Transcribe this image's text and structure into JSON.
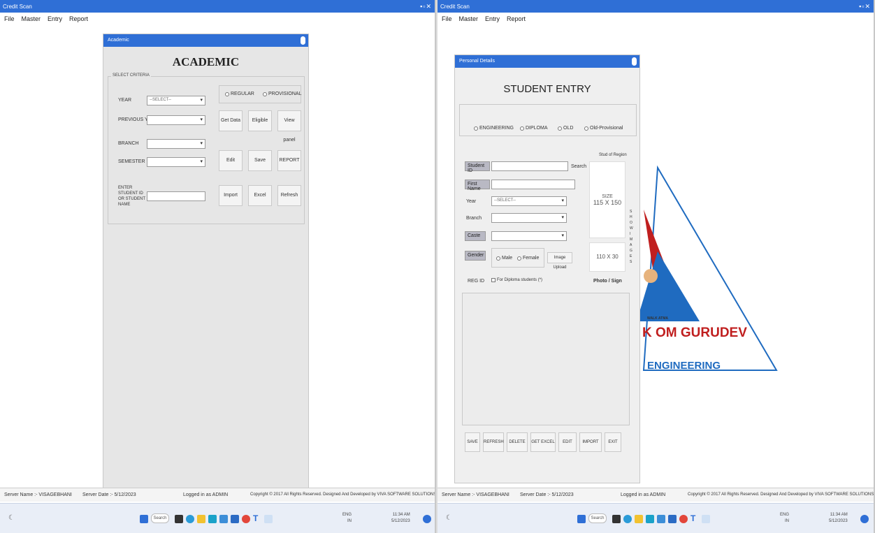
{
  "colors": {
    "titlebar": "#2f6fd6",
    "accent_red": "#c01f1f",
    "accent_blue": "#1f6bc0"
  },
  "window": {
    "title": "Credit Scan",
    "controls": "▪▫✕",
    "menu": [
      "File",
      "Master",
      "Entry",
      "Report"
    ]
  },
  "status": {
    "server_name": "Server Name :- VISAGEBHANI",
    "server_date": "Server Date :- 5/12/2023",
    "logged_in": "Logged in as ADMIN",
    "copyright": "Copyright © 2017 All Rights Reserved. Designed And Developed by VIVA SOFTWARE SOLUTIONS"
  },
  "taskbar": {
    "search": "Search",
    "tray_lang": "ENG\nIN",
    "tray_time": "11:34 AM\n5/12/2023"
  },
  "academic": {
    "title": "Academic",
    "heading": "ACADEMIC",
    "criteria_legend": "SELECT CRITERIA",
    "year_label": "YEAR",
    "year_value": "--SELECT--",
    "prev_year_label": "PREVIOUS YEAR",
    "branch_label": "BRANCH",
    "semester_label": "SEMESTER",
    "enter_label": "ENTER STUDENT ID OR STUDENT NAME",
    "regular": "REGULAR",
    "provisional": "PROVISIONAL",
    "buttons": {
      "get_data": "Get Data",
      "eligible": "Eligible",
      "view_panel": "View panel",
      "edit": "Edit",
      "save": "Save",
      "report": "REPORT",
      "import": "Import",
      "excel": "Excel",
      "refresh": "Refresh"
    }
  },
  "student": {
    "title": "Personal Details",
    "heading": "STUDENT ENTRY",
    "types": [
      "ENGINEERING",
      "DIPLOMA",
      "OLD",
      "Old-Provisional"
    ],
    "student_id_label": "Student ID",
    "search": "Search",
    "first_name_label": "First Name",
    "year_label": "Year",
    "year_value": "--SELECT--",
    "branch_label": "Branch",
    "caste_label": "Caste",
    "gender_label": "Gender",
    "male": "Male",
    "female": "Female",
    "image_upload": "Image Upload",
    "regid": "REG ID",
    "diploma_check": "For Diploma students (*)",
    "photo_header": "Stud of Region",
    "size_label": "SIZE",
    "size_value": "115 X 150",
    "sign_value": "110 X 30",
    "photo_sign": "Photo / Sign",
    "side_text": "S H O W   I M A G E S",
    "buttons": {
      "save": "SAVE",
      "refresh": "REFRESH",
      "delete": "DELETE",
      "get_excel": "GET EXCEL",
      "edit": "EDIT",
      "import": "IMPORT",
      "exit": "EXIT"
    }
  },
  "logo": {
    "tagline": "WALK ATMA",
    "name": "K OM GURUDEV",
    "sub": "ENGINEERING"
  }
}
